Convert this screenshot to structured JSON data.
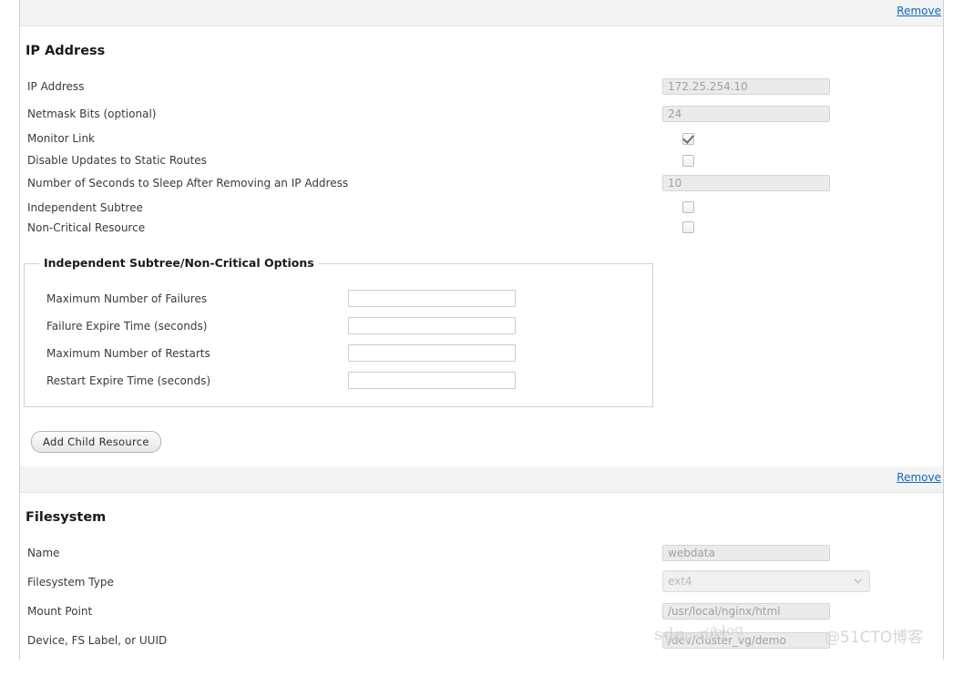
{
  "blocks": [
    {
      "remove_label": "Remove",
      "title": "IP Address",
      "rows": [
        {
          "label": "IP Address",
          "type": "text",
          "value": "172.25.254.10",
          "name": "ip-address"
        },
        {
          "label": "Netmask Bits (optional)",
          "type": "text",
          "value": "24",
          "name": "netmask-bits"
        },
        {
          "label": "Monitor Link",
          "type": "checkbox",
          "checked": true,
          "name": "monitor-link"
        },
        {
          "label": "Disable Updates to Static Routes",
          "type": "checkbox",
          "checked": false,
          "name": "disable-static-route-updates"
        },
        {
          "label": "Number of Seconds to Sleep After Removing an IP Address",
          "type": "text",
          "value": "10",
          "name": "sleep-seconds"
        },
        {
          "label": "Independent Subtree",
          "type": "checkbox",
          "checked": false,
          "name": "independent-subtree"
        },
        {
          "label": "Non-Critical Resource",
          "type": "checkbox",
          "checked": false,
          "name": "non-critical-resource"
        }
      ],
      "fieldset": {
        "legend": "Independent Subtree/Non-Critical Options",
        "rows": [
          {
            "label": "Maximum Number of Failures",
            "value": "",
            "name": "max-number-of-failures"
          },
          {
            "label": "Failure Expire Time (seconds)",
            "value": "",
            "name": "failure-expire-time"
          },
          {
            "label": "Maximum Number of Restarts",
            "value": "",
            "name": "max-number-of-restarts"
          },
          {
            "label": "Restart Expire Time (seconds)",
            "value": "",
            "name": "restart-expire-time"
          }
        ]
      },
      "button_label": "Add Child Resource"
    },
    {
      "remove_label": "Remove",
      "title": "Filesystem",
      "rows": [
        {
          "label": "Name",
          "type": "text",
          "value": "webdata",
          "name": "filesystem-name"
        },
        {
          "label": "Filesystem Type",
          "type": "select",
          "value": "ext4",
          "name": "filesystem-type"
        },
        {
          "label": "Mount Point",
          "type": "text",
          "value": "/usr/local/nginx/html",
          "name": "mount-point"
        },
        {
          "label": "Device, FS Label, or UUID",
          "type": "text",
          "value": "/dev/cluster_vg/demo",
          "name": "device-fs-label-uuid"
        }
      ]
    }
  ],
  "watermark": {
    "line_a": "sdn. net",
    "line_b": "https://blog.",
    "line_c": "@51CTO博客"
  },
  "colors": {
    "link": "#0b69c7",
    "header_band": "#f3f3f3",
    "disabled_field": "#ebebeb",
    "text": "#333333"
  }
}
